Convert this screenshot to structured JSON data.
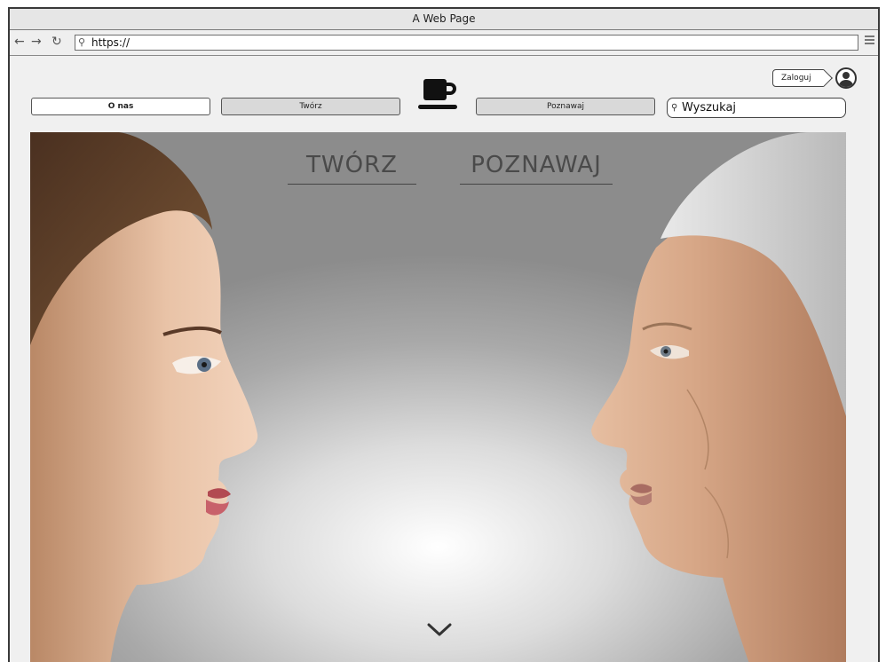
{
  "browser": {
    "title": "A Web Page",
    "url": "https://",
    "back_icon": "arrow-left-icon",
    "forward_icon": "arrow-right-icon",
    "reload_icon": "reload-icon",
    "menu_icon": "hamburger-icon"
  },
  "header": {
    "login_label": "Zaloguj",
    "avatar_icon": "user-avatar-icon",
    "logo_icon": "coffee-cup-icon",
    "nav": {
      "about": "O nas",
      "create": "Twórz",
      "explore": "Poznawaj"
    },
    "search": {
      "placeholder": "Wyszukaj",
      "icon": "search-icon"
    }
  },
  "hero": {
    "link_create": "TWÓRZ",
    "link_explore": "POZNAWAJ",
    "scroll_icon": "chevron-down-icon"
  }
}
